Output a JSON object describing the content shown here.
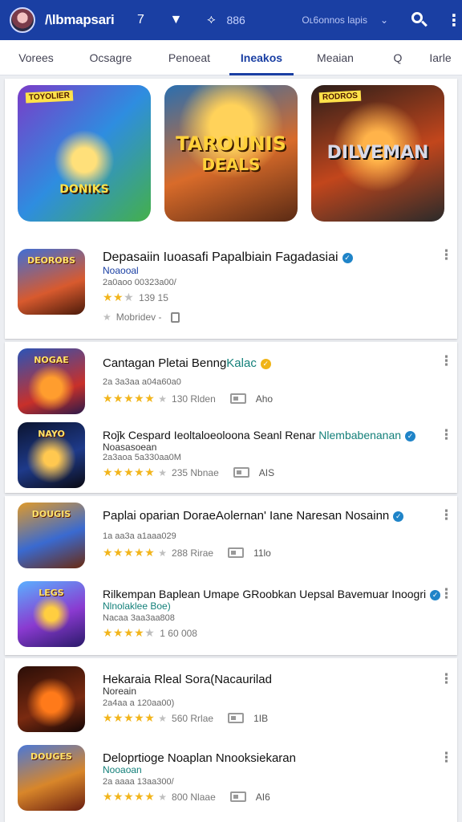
{
  "header": {
    "app_name": "/\\lbmapsari",
    "icon_a": "7",
    "icon_b": "▼",
    "icon_c": "⟡",
    "count": "886",
    "account": "Oʟ6onnos lapis",
    "icons": [
      "avatar",
      "signal-icon",
      "filter-icon",
      "share-icon",
      "chevron-down-icon",
      "search-icon",
      "more-vert-icon"
    ]
  },
  "tabs": [
    {
      "label": "Vorees"
    },
    {
      "label": "Ocsagre"
    },
    {
      "label": "Penoeat"
    },
    {
      "label": "Ineakos",
      "active": true
    },
    {
      "label": "Meaian"
    },
    {
      "label": "Q"
    },
    {
      "label": "Iarle"
    }
  ],
  "featured": [
    {
      "title": "TOYOLIER",
      "tag": "TOYOLIER",
      "logo": "DONIKS"
    },
    {
      "title": "TAROUNIS",
      "logo": "DEALS"
    },
    {
      "title": "DILVEMAN",
      "tag": "RODROS"
    }
  ],
  "colors": {
    "brand": "#1a3fa3",
    "star": "#f2b51c",
    "verified": "#1f84c8",
    "link": "#14807a"
  },
  "apps": [
    {
      "icon_text": "DEOROBS",
      "title": "Depasaiin Iuoasafi Papalbiain  Fagadasiai",
      "verified": true,
      "sub": "Noaooal",
      "meta": "2a0aoo 00323a00/",
      "stars": "★★★★★",
      "rating_text": "139 15",
      "extra": "Mobridev -"
    },
    {
      "icon_text": "NOGAE",
      "title": "Cantagan  Pletai Benng",
      "title_link": "Kalac",
      "verified_gold": true,
      "meta": "2a 3a3aa a04a60a0",
      "stars": "★★★★★",
      "reviews": "130 Rlden",
      "size": "Aho"
    },
    {
      "icon_text": "NAYO",
      "title": "Roǰk Cespard Ieoltaloeoloona Seanl Renar",
      "title_link": "Nlembabenanan",
      "verified": true,
      "sub": "Noasasoean",
      "meta": "2a3aoa 5a330aa0M",
      "stars": "★★★★★",
      "reviews": "235 Nbnae",
      "size": "AIS"
    },
    {
      "icon_text": "DOUGIS",
      "title": "Paplai  oparian DoraeAolernan' Iane Naresan Nosainn",
      "verified": true,
      "meta": "1a aa3a a1aaa029",
      "stars": "★★★★★",
      "reviews": "288 Rirae",
      "size": "11lo"
    },
    {
      "icon_text": "LEGS",
      "title": "Rilkempan  Baplean Umape GRoobkan Uepsal Bavemuar Inoogri",
      "verified": true,
      "sub": "Nlnolaklee Boe)",
      "meta": "Nacaa 3aa3aa808",
      "stars": "★★★★★",
      "reviews": "1 60 008",
      "size": ""
    },
    {
      "icon_text": "",
      "title": "Hekaraia Rleal Sora(Nacaurilad",
      "sub": "Noreain",
      "meta": "2a4aa a 120aa00)",
      "stars": "★★★★★",
      "reviews": "560 Rrlae",
      "size": "1IB"
    },
    {
      "icon_text": "DOUGES",
      "title": "Deloprtioge  Noaplan  Nnooksiekaran",
      "sub": "Nooaoan",
      "meta": "2a aaaa 13aa300/",
      "stars": "★★★★★",
      "reviews": "800 Nlaae",
      "size": "AI6"
    }
  ]
}
